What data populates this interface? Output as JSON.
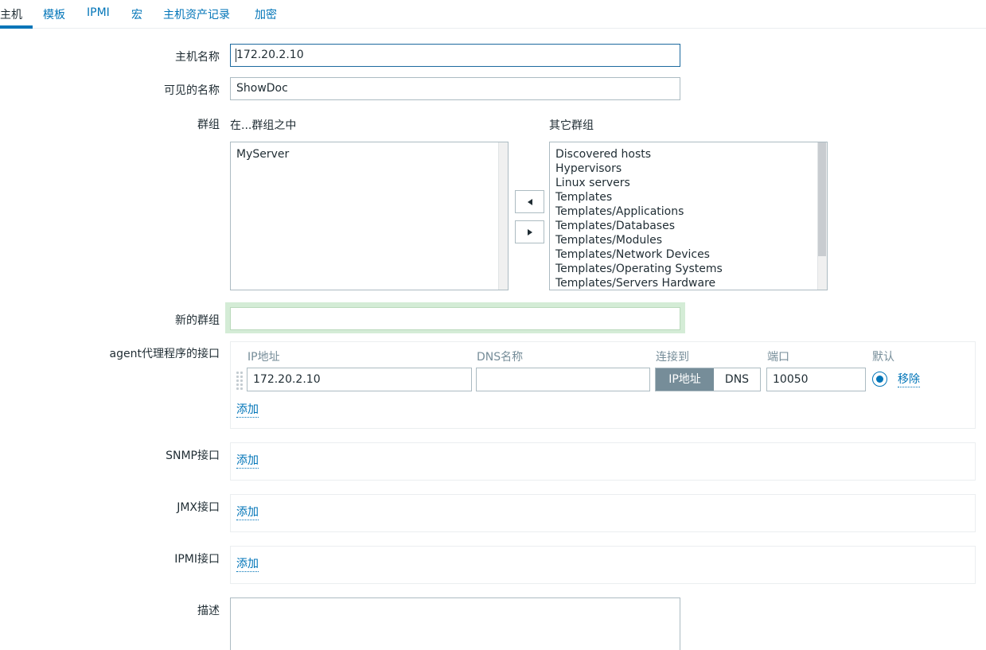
{
  "tabs": [
    {
      "label": "主机",
      "active": true
    },
    {
      "label": "模板",
      "active": false
    },
    {
      "label": "IPMI",
      "active": false
    },
    {
      "label": "宏",
      "active": false
    },
    {
      "label": "主机资产记录",
      "active": false
    },
    {
      "label": "加密",
      "active": false
    }
  ],
  "form": {
    "host_name": {
      "label": "主机名称",
      "value": "172.20.2.10"
    },
    "visible_name": {
      "label": "可见的名称",
      "value": "ShowDoc"
    },
    "groups": {
      "label": "群组",
      "in_groups_header": "在...群组之中",
      "other_groups_header": "其它群组",
      "in_groups": [
        "MyServer"
      ],
      "other_groups": [
        "Discovered hosts",
        "Hypervisors",
        "Linux servers",
        "Templates",
        "Templates/Applications",
        "Templates/Databases",
        "Templates/Modules",
        "Templates/Network Devices",
        "Templates/Operating Systems",
        "Templates/Servers Hardware"
      ]
    },
    "new_group": {
      "label": "新的群组",
      "value": ""
    },
    "agent_interface": {
      "label": "agent代理程序的接口",
      "columns": {
        "ip": "IP地址",
        "dns": "DNS名称",
        "connect_to": "连接到",
        "port": "端口",
        "default": "默认"
      },
      "rows": [
        {
          "ip": "172.20.2.10",
          "dns": "",
          "connect_ip": "IP地址",
          "connect_dns": "DNS",
          "connect_selected": "IP地址",
          "port": "10050",
          "is_default": true,
          "remove_label": "移除"
        }
      ],
      "add_label": "添加"
    },
    "snmp_interface": {
      "label": "SNMP接口",
      "add_label": "添加"
    },
    "jmx_interface": {
      "label": "JMX接口",
      "add_label": "添加"
    },
    "ipmi_interface": {
      "label": "IPMI接口",
      "add_label": "添加"
    },
    "description": {
      "label": "描述",
      "value": ""
    }
  },
  "colors": {
    "link": "#0275b8",
    "active_segment": "#768d99",
    "focus_border": "#1d6a9f"
  },
  "icons": {
    "move_left": "triangle-left-icon",
    "move_right": "triangle-right-icon",
    "drag": "drag-handle-icon"
  }
}
